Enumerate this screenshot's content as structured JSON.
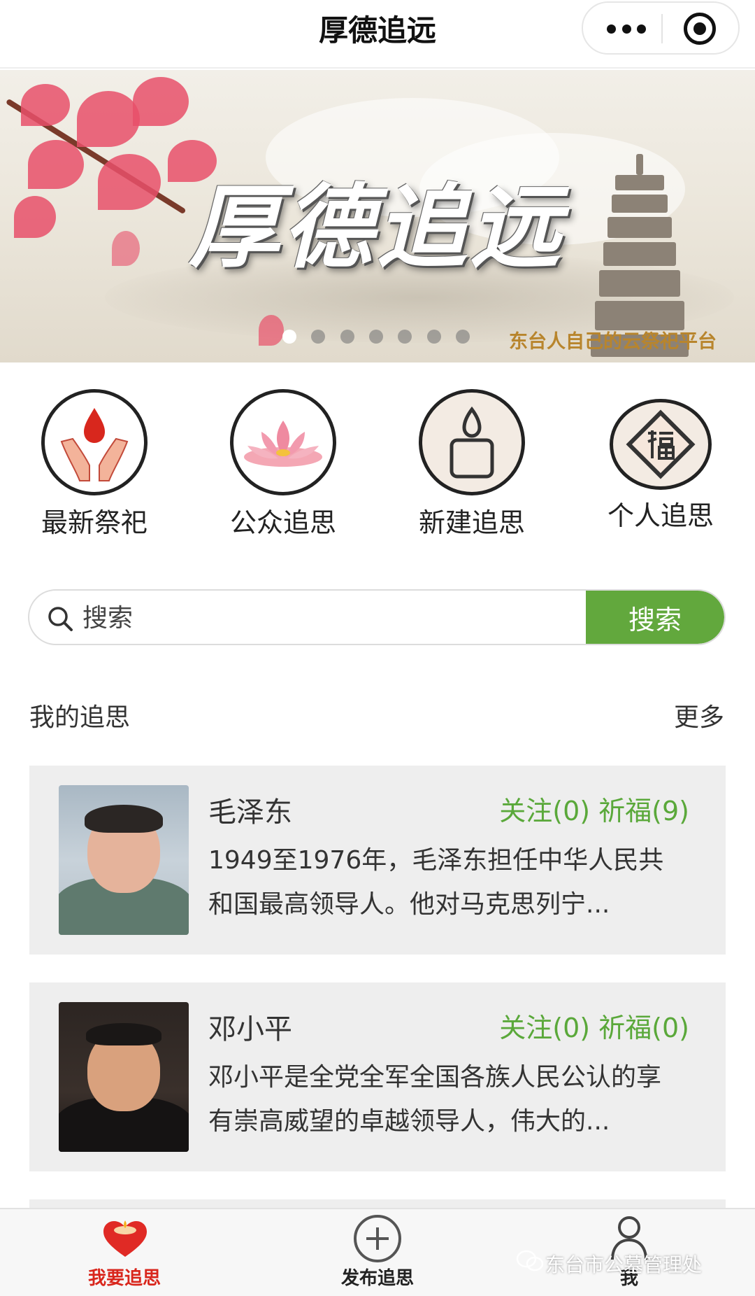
{
  "navbar": {
    "title": "厚德追远",
    "more_icon": "more-dots-icon",
    "close_icon": "target-close-icon"
  },
  "banner": {
    "title": "厚德追远",
    "slogan": "东台人自己的云祭祀平台",
    "slide_count": 7,
    "active_slide": 1
  },
  "menu": {
    "items": [
      {
        "label": "最新祭祀",
        "icon": "hands-blood-drop-icon"
      },
      {
        "label": "公众追思",
        "icon": "lotus-icon"
      },
      {
        "label": "新建追思",
        "icon": "candle-icon"
      },
      {
        "label": "个人追思",
        "icon": "fu-blessing-icon"
      }
    ]
  },
  "search": {
    "placeholder": "搜索",
    "value": "",
    "button_label": "搜索"
  },
  "section": {
    "title": "我的追思",
    "more_label": "更多"
  },
  "memorials": [
    {
      "name": "毛泽东",
      "stats": "关注(0) 祈福(9)",
      "description": "1949至1976年，毛泽东担任中华人民共和国最高领导人。他对马克思列宁..."
    },
    {
      "name": "邓小平",
      "stats": "关注(0) 祈福(0)",
      "description": "邓小平是全党全军全国各族人民公认的享有崇高威望的卓越领导人，伟大的..."
    }
  ],
  "tabbar": {
    "tabs": [
      {
        "label": "我要追思",
        "icon": "heart-candle-icon",
        "active": true
      },
      {
        "label": "发布追思",
        "icon": "plus-circle-icon",
        "active": false
      },
      {
        "label": "我",
        "icon": "user-icon",
        "active": false
      }
    ]
  },
  "watermark": "东台市公墓管理处",
  "colors": {
    "accent_green": "#62a83d",
    "stats_green": "#5aa83a",
    "active_tab_red": "#d9261c",
    "slogan_gold": "#b8852d"
  }
}
